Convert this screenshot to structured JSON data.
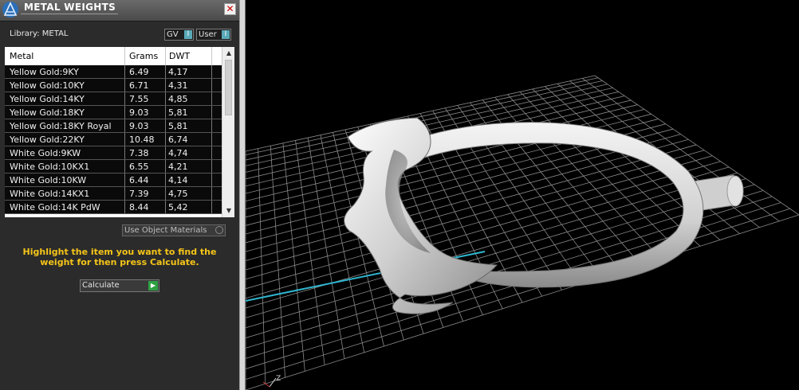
{
  "panel": {
    "title": "METAL WEIGHTS",
    "close_icon": "close-icon",
    "library_label": "Library: METAL",
    "gv_label": "GV",
    "user_label": "User",
    "columns": [
      "Metal",
      "Grams",
      "DWT"
    ],
    "rows": [
      {
        "metal": "Yellow Gold:9KY",
        "grams": "6.49",
        "dwt": "4,17"
      },
      {
        "metal": "Yellow Gold:10KY",
        "grams": "6.71",
        "dwt": "4,31"
      },
      {
        "metal": "Yellow Gold:14KY",
        "grams": "7.55",
        "dwt": "4,85"
      },
      {
        "metal": "Yellow Gold:18KY",
        "grams": "9.03",
        "dwt": "5,81"
      },
      {
        "metal": "Yellow Gold:18KY Royal",
        "grams": "9.03",
        "dwt": "5,81"
      },
      {
        "metal": "Yellow Gold:22KY",
        "grams": "10.48",
        "dwt": "6,74"
      },
      {
        "metal": "White Gold:9KW",
        "grams": "7.38",
        "dwt": "4,74"
      },
      {
        "metal": "White Gold:10KX1",
        "grams": "6.55",
        "dwt": "4,21"
      },
      {
        "metal": "White Gold:10KW",
        "grams": "6.44",
        "dwt": "4,14"
      },
      {
        "metal": "White Gold:14KX1",
        "grams": "7.39",
        "dwt": "4,75"
      },
      {
        "metal": "White Gold:14K PdW",
        "grams": "8.44",
        "dwt": "5,42"
      }
    ],
    "use_object_materials": "Use Object Materials",
    "hint": "Highlight the item you want to find the weight for then press Calculate.",
    "calculate_label": "Calculate"
  },
  "viewport": {
    "axis_label": "Z"
  },
  "colors": {
    "hint": "#f5c518",
    "grid": "#8a8a8a",
    "axis": "#2fb6d0"
  }
}
